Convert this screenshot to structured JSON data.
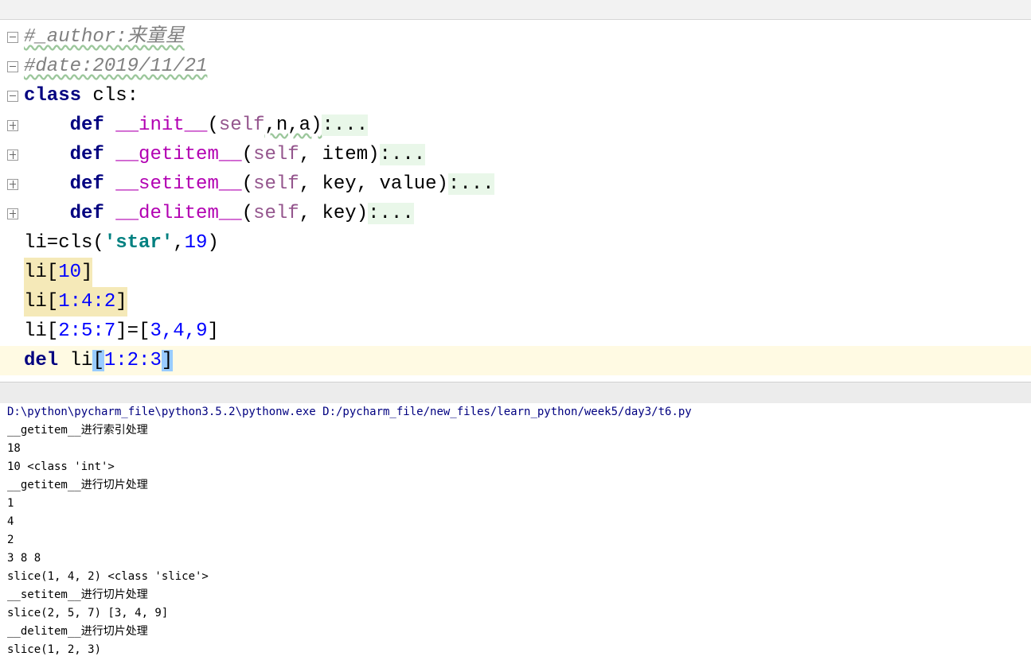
{
  "editor": {
    "line1": {
      "comment": "#_author:来童星"
    },
    "line2": {
      "comment": "#date:2019/11/21"
    },
    "line3": {
      "kw": "class",
      "rest": " cls:"
    },
    "line4": {
      "indent": "    ",
      "kw": "def",
      "sp": " ",
      "name": "__init__",
      "open": "(",
      "self": "self",
      "params": ",n,a)",
      "fold": ":..."
    },
    "line5": {
      "indent": "    ",
      "kw": "def",
      "sp": " ",
      "name": "__getitem__",
      "open": "(",
      "self": "self",
      "params": ", item)",
      "fold": ":..."
    },
    "line6": {
      "indent": "    ",
      "kw": "def",
      "sp": " ",
      "name": "__setitem__",
      "open": "(",
      "self": "self",
      "params": ", key, value)",
      "fold": ":..."
    },
    "line7": {
      "indent": "    ",
      "kw": "def",
      "sp": " ",
      "name": "__delitem__",
      "open": "(",
      "self": "self",
      "params": ", key)",
      "fold": ":..."
    },
    "line8": {
      "a": "li=cls(",
      "str": "'star'",
      "b": ",",
      "num": "19",
      "c": ")"
    },
    "line9": {
      "a": "li[",
      "num": "10",
      "c": "]"
    },
    "line10": {
      "a": "li[",
      "num": "1:4:2",
      "c": "]"
    },
    "line11": {
      "a": "li[",
      "n1": "2:5:7",
      "b": "]=[",
      "n2": "3,4,9",
      "c": "]"
    },
    "line12": {
      "kw": "del",
      "a": " li",
      "lb": "[",
      "num": "1:2:3",
      "rb": "]"
    }
  },
  "console": {
    "lines": [
      "D:\\python\\pycharm_file\\python3.5.2\\pythonw.exe D:/pycharm_file/new_files/learn_python/week5/day3/t6.py",
      "__getitem__进行索引处理",
      "18",
      "10 <class 'int'>",
      "__getitem__进行切片处理",
      "1",
      "4",
      "2",
      "3 8 8",
      "slice(1, 4, 2) <class 'slice'>",
      "__setitem__进行切片处理",
      "slice(2, 5, 7) [3, 4, 9]",
      "__delitem__进行切片处理",
      "slice(1, 2, 3)"
    ]
  }
}
